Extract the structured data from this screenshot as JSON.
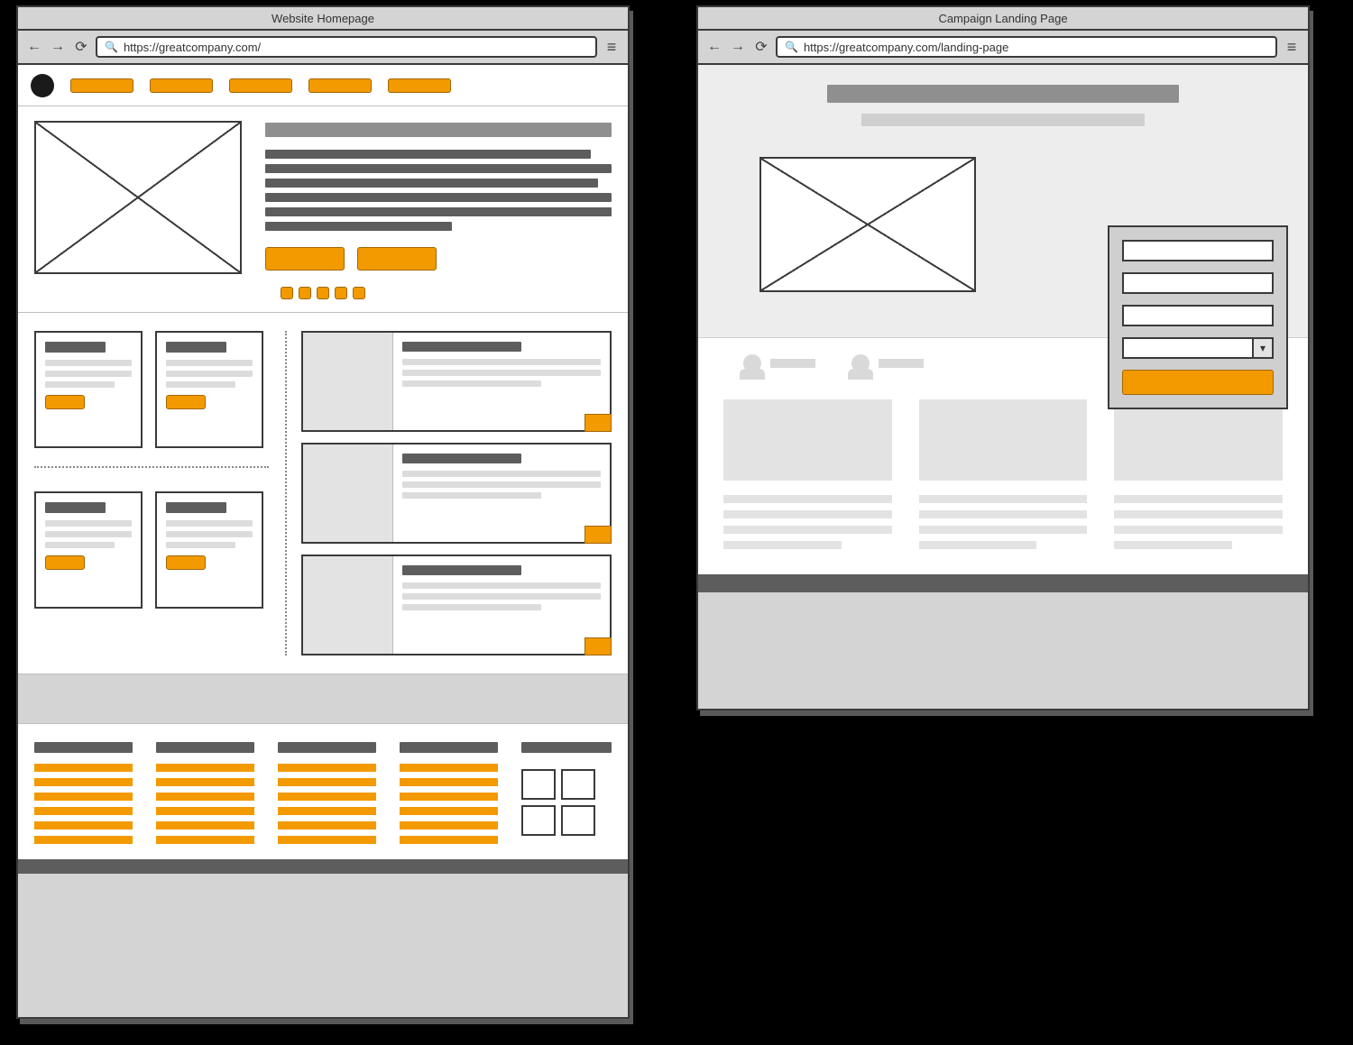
{
  "homepage": {
    "title": "Website Homepage",
    "url": "https://greatcompany.com/",
    "nav_items": 5,
    "hero": {
      "text_lines": 6,
      "cta_count": 2,
      "carousel_dots": 5
    },
    "cards": {
      "count": 4
    },
    "list_items": {
      "count": 3
    },
    "footer": {
      "columns": 4,
      "links_per_column": 6,
      "grid_tiles": 4
    }
  },
  "landing": {
    "title": "Campaign Landing Page",
    "url": "https://greatcompany.com/landing-page",
    "form": {
      "inputs": 3,
      "selects": 1,
      "submit": 1
    },
    "users": 2,
    "feature_columns": 3,
    "feature_text_lines": 4
  },
  "colors": {
    "accent": "#f29a00",
    "mid_gray": "#8f8f8f",
    "dark_gray": "#5d5d5d",
    "light_gray": "#e3e3e3",
    "chrome": "#d4d4d4"
  }
}
